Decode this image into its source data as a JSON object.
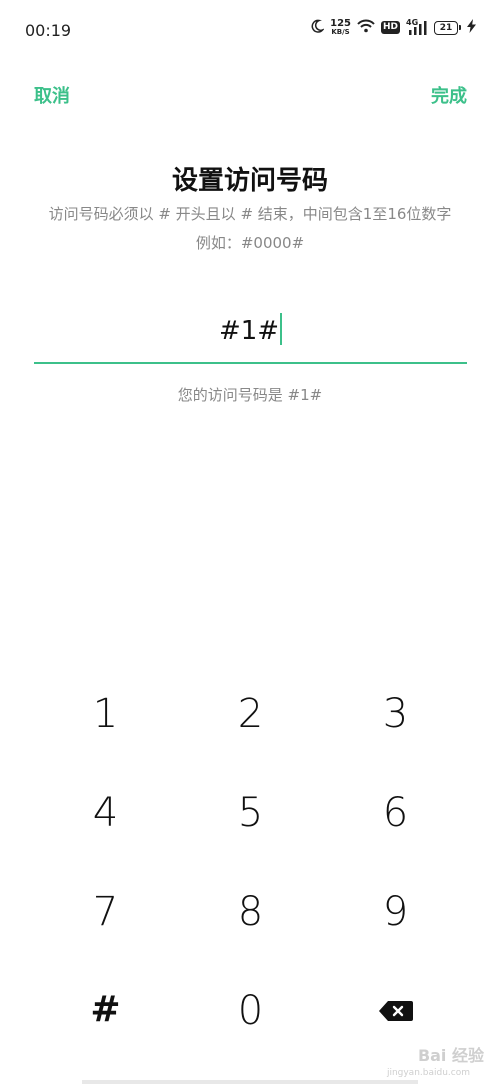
{
  "status_bar": {
    "time": "00:19",
    "net_speed_value": "125",
    "net_speed_unit": "KB/S",
    "hd_label": "HD",
    "network_type": "4G",
    "battery_level": "21",
    "icons": [
      "moon-icon",
      "wifi-icon",
      "hd-icon",
      "signal-icon",
      "battery-icon",
      "charging-icon"
    ]
  },
  "nav": {
    "cancel_label": "取消",
    "done_label": "完成"
  },
  "page": {
    "title": "设置访问号码",
    "description": "访问号码必须以 # 开头且以 # 结束，中间包含1至16位数字",
    "example": "例如：#0000#"
  },
  "input": {
    "value": "#1#"
  },
  "result_text": "您的访问号码是 #1#",
  "keypad": {
    "keys": [
      "1",
      "2",
      "3",
      "4",
      "5",
      "6",
      "7",
      "8",
      "9",
      "#",
      "0"
    ],
    "delete_icon": "backspace-icon"
  },
  "watermark": {
    "text": "Bai 经验",
    "sub": "jingyan.baidu.com"
  },
  "colors": {
    "accent": "#3cc08a",
    "text": "#111111",
    "secondary": "#888888"
  }
}
